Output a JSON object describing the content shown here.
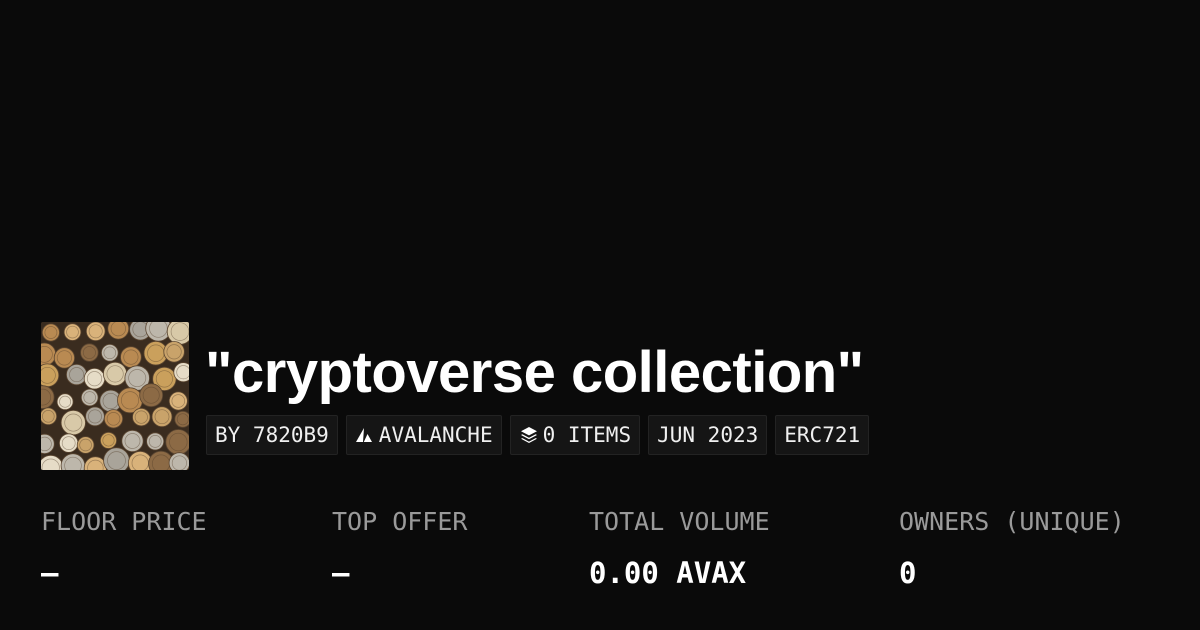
{
  "collection": {
    "title": "\"cryptoverse collection\"",
    "thumbnail_icon": "coins-image"
  },
  "chips": [
    {
      "label": "BY 7820B9"
    },
    {
      "label": "AVALANCHE",
      "icon": "avalanche-icon"
    },
    {
      "label": "0 ITEMS",
      "icon": "layers-icon"
    },
    {
      "label": "JUN 2023"
    },
    {
      "label": "ERC721"
    }
  ],
  "stats": [
    {
      "label": "FLOOR PRICE",
      "value": "–"
    },
    {
      "label": "TOP OFFER",
      "value": "–"
    },
    {
      "label": "TOTAL VOLUME",
      "value": "0.00 AVAX"
    },
    {
      "label": "OWNERS (UNIQUE)",
      "value": "0"
    }
  ],
  "colors": {
    "background": "#0a0a0a",
    "chip_background": "#151515",
    "label_gray": "#9a9a9a",
    "text": "#ffffff"
  }
}
